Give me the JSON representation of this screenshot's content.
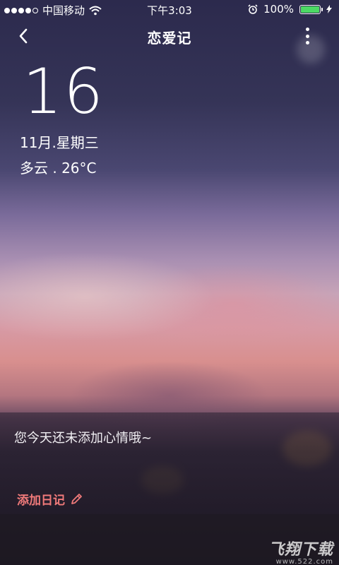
{
  "status_bar": {
    "carrier": "中国移动",
    "time": "下午3:03",
    "battery_percent": "100%",
    "battery_level": 1.0,
    "battery_color": "#4cd964"
  },
  "nav": {
    "title": "恋爱记",
    "back_icon": "chevron-left-icon",
    "more_icon": "more-vertical-icon"
  },
  "date": {
    "day": "16",
    "month_weekday": "11月.星期三",
    "weather": "多云 . 26°C"
  },
  "mood": {
    "prompt": "您今天还未添加心情哦~",
    "add_label": "添加日记",
    "add_color": "#f07a7a"
  },
  "watermark": {
    "title": "飞翔下载",
    "url": "www.522.com"
  }
}
